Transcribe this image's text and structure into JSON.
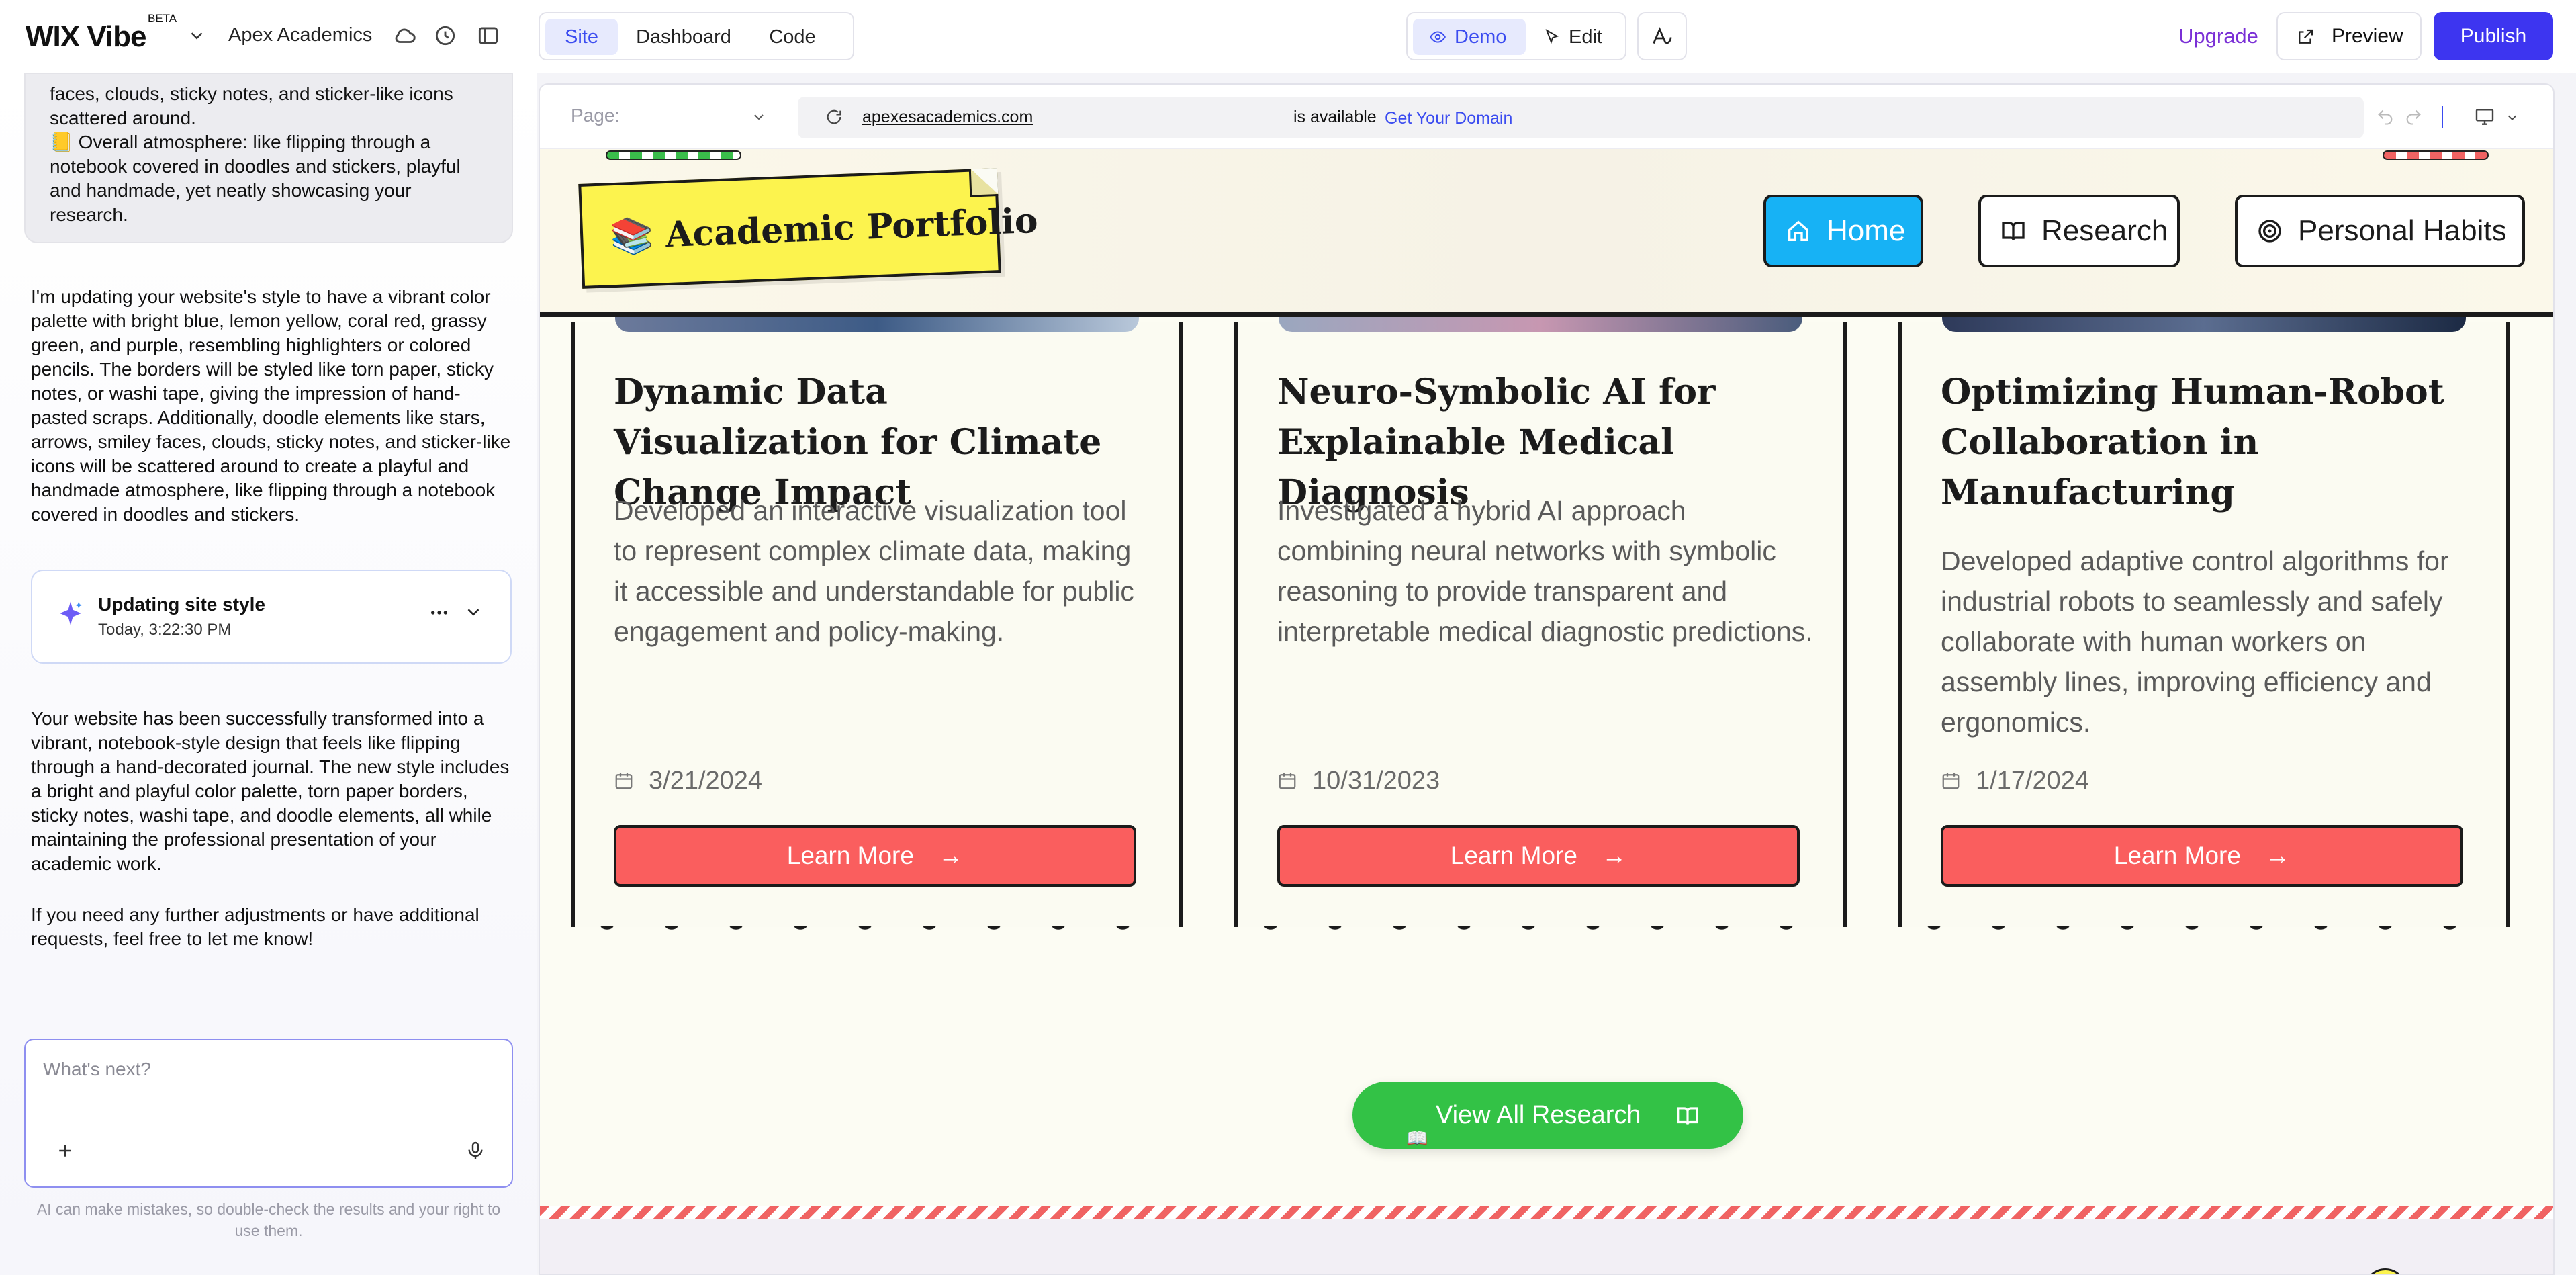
{
  "topbar": {
    "logo_text": "WIX Vibe",
    "logo_badge": "BETA",
    "site_name": "Apex Academics",
    "tabs": [
      {
        "label": "Site"
      },
      {
        "label": "Dashboard"
      },
      {
        "label": "Code"
      }
    ],
    "mode_demo": "Demo",
    "mode_edit": "Edit",
    "upgrade": "Upgrade",
    "preview": "Preview",
    "publish": "Publish",
    "accent": "#3d35f0"
  },
  "chat": {
    "user_bubble": "faces, clouds, sticky notes, and sticker-like icons scattered around.\n📒 Overall atmosphere: like flipping through a notebook covered in doodles and stickers, playful and handmade, yet neatly showcasing your research.",
    "msg_1": "I'm updating your website's style to have a vibrant color palette with bright blue, lemon yellow, coral red, grassy green, and purple, resembling highlighters or colored pencils. The borders will be styled like torn paper, sticky notes, or washi tape, giving the impression of hand-pasted scraps. Additionally, doodle elements like stars, arrows, smiley faces, clouds, sticky notes, and sticker-like icons will be scattered around to create a playful and handmade atmosphere, like flipping through a notebook covered in doodles and stickers.",
    "status_title": "Updating site style",
    "status_time": "Today, 3:22:30 PM",
    "msg_2": "Your website has been successfully transformed into a vibrant, notebook-style design that feels like flipping through a hand-decorated journal. The new style includes a bright and playful color palette, torn paper borders, sticky notes, washi tape, and doodle elements, all while maintaining the professional presentation of your academic work.",
    "msg_3": "If you need any further adjustments or have additional requests, feel free to let me know!",
    "composer_placeholder": "What's next?",
    "disclaimer": "AI can make mistakes, so double-check the results and your right to use them."
  },
  "browser": {
    "page_label": "Page:",
    "domain": "apexesacademics.com",
    "available": "is available",
    "get_domain": "Get Your Domain"
  },
  "site": {
    "portfolio_title": "📚 Academic Portfolio",
    "nav": [
      {
        "label": "Home"
      },
      {
        "label": "Research"
      },
      {
        "label": "Personal Habits"
      }
    ],
    "cards": [
      {
        "title": "Dynamic Data Visualization for Climate Change Impact",
        "description": "Developed an interactive visualization tool to represent complex climate data, making it accessible and understandable for public engagement and policy-making.",
        "date": "3/21/2024",
        "button": "Learn More"
      },
      {
        "title": "Neuro-Symbolic AI for Explainable Medical Diagnosis",
        "description": "Investigated a hybrid AI approach combining neural networks with symbolic reasoning to provide transparent and interpretable medical diagnostic predictions.",
        "date": "10/31/2023",
        "button": "Learn More"
      },
      {
        "title": "Optimizing Human-Robot Collaboration in Manufacturing",
        "description": "Developed adaptive control algorithms for industrial robots to seamlessly and safely collaborate with human workers on assembly lines, improving efficiency and ergonomics.",
        "date": "1/17/2024",
        "button": "Learn More"
      }
    ],
    "view_all": "View All Research",
    "colors": {
      "nav_active": "#17b2f5",
      "sticky_note": "#fcf34e",
      "learn_more": "#fa5e5e",
      "view_all": "#33c246"
    }
  }
}
